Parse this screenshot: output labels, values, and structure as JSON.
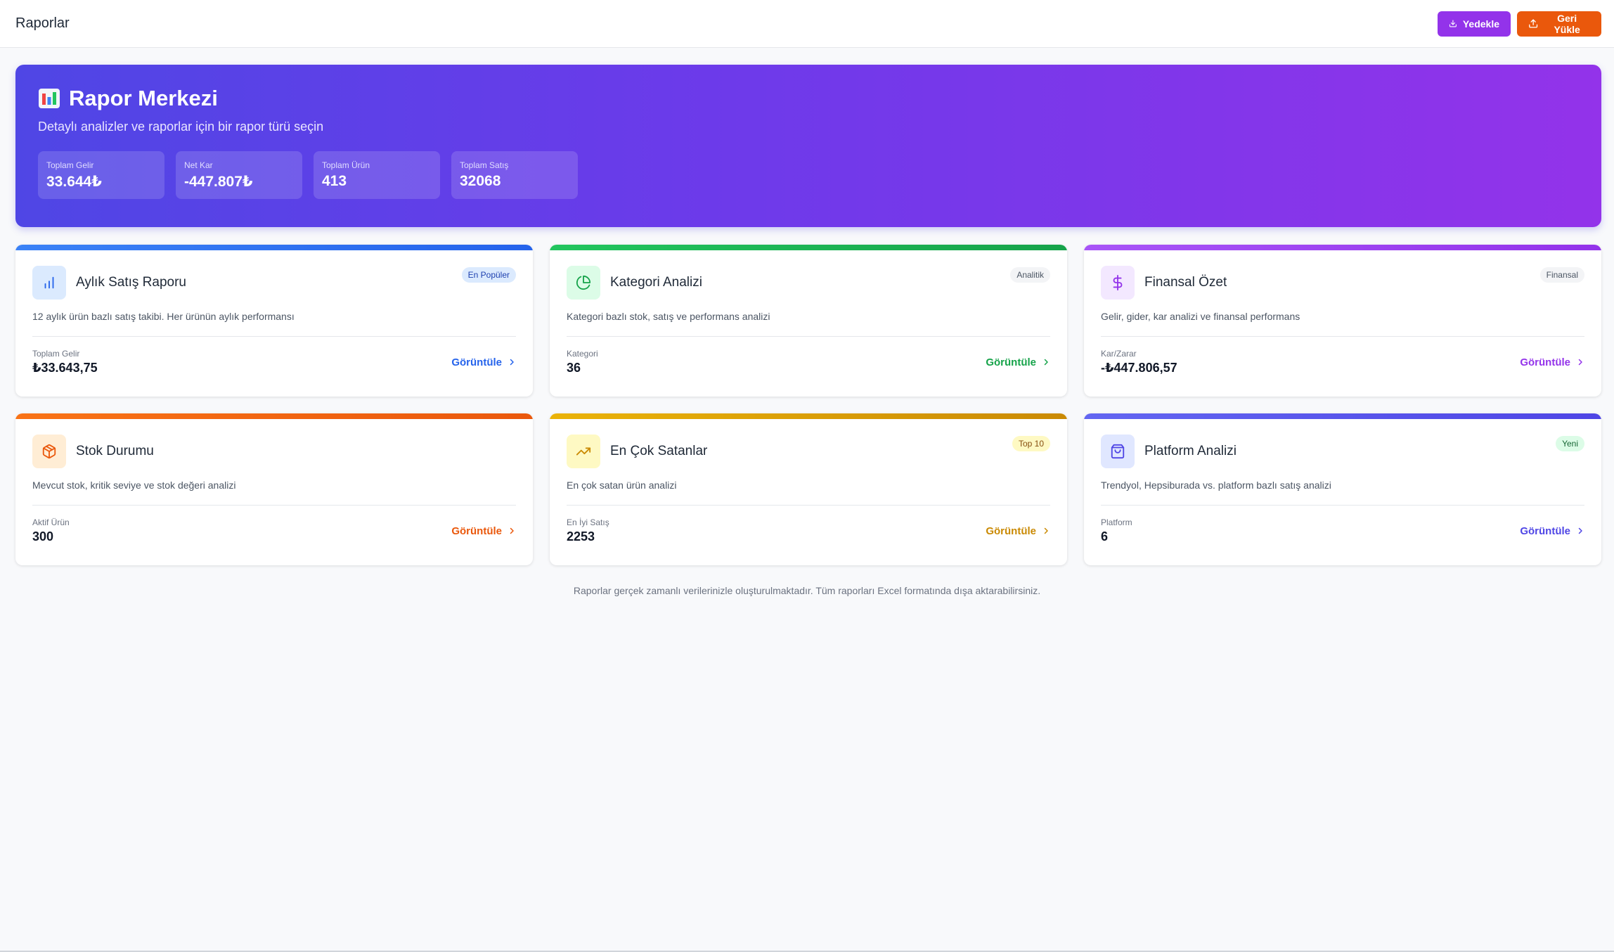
{
  "header": {
    "title": "Raporlar",
    "backup_label": "Yedekle",
    "restore_label": "Geri Yükle",
    "backup_color": "#9333ea",
    "restore_color": "#ea580c"
  },
  "hero": {
    "icon": "bar-chart-emoji-icon",
    "title": "Rapor Merkezi",
    "subtitle": "Detaylı analizler ve raporlar için bir rapor türü seçin",
    "stats": [
      {
        "label": "Toplam Gelir",
        "value": "33.644₺"
      },
      {
        "label": "Net Kar",
        "value": "-447.807₺"
      },
      {
        "label": "Toplam Ürün",
        "value": "413"
      },
      {
        "label": "Toplam Satış",
        "value": "32068"
      }
    ]
  },
  "cards": [
    {
      "title": "Aylık Satış Raporu",
      "badge": "En Popüler",
      "icon": "bar-chart-icon",
      "description": "12 aylık ürün bazlı satış takibi. Her ürünün aylık performansı",
      "metric_label": "Toplam Gelir",
      "metric_value": "₺33.643,75",
      "link": "Görüntüle",
      "accent": "#3b82f6"
    },
    {
      "title": "Kategori Analizi",
      "badge": "Analitik",
      "icon": "pie-chart-icon",
      "description": "Kategori bazlı stok, satış ve performans analizi",
      "metric_label": "Kategori",
      "metric_value": "36",
      "link": "Görüntüle",
      "accent": "#22c55e"
    },
    {
      "title": "Finansal Özet",
      "badge": "Finansal",
      "icon": "dollar-icon",
      "description": "Gelir, gider, kar analizi ve finansal performans",
      "metric_label": "Kar/Zarar",
      "metric_value": "-₺447.806,57",
      "link": "Görüntüle",
      "accent": "#a855f7"
    },
    {
      "title": "Stok Durumu",
      "badge": "",
      "icon": "package-icon",
      "description": "Mevcut stok, kritik seviye ve stok değeri analizi",
      "metric_label": "Aktif Ürün",
      "metric_value": "300",
      "link": "Görüntüle",
      "accent": "#f97316"
    },
    {
      "title": "En Çok Satanlar",
      "badge": "Top 10",
      "icon": "trending-up-icon",
      "description": "En çok satan ürün analizi",
      "metric_label": "En İyi Satış",
      "metric_value": "2253",
      "link": "Görüntüle",
      "accent": "#eab308"
    },
    {
      "title": "Platform Analizi",
      "badge": "Yeni",
      "icon": "shopping-bag-icon",
      "description": "Trendyol, Hepsiburada vs. platform bazlı satış analizi",
      "metric_label": "Platform",
      "metric_value": "6",
      "link": "Görüntüle",
      "accent": "#6366f1"
    }
  ],
  "footer": {
    "note": "Raporlar gerçek zamanlı verilerinizle oluşturulmaktadır. Tüm raporları Excel formatında dışa aktarabilirsiniz."
  }
}
